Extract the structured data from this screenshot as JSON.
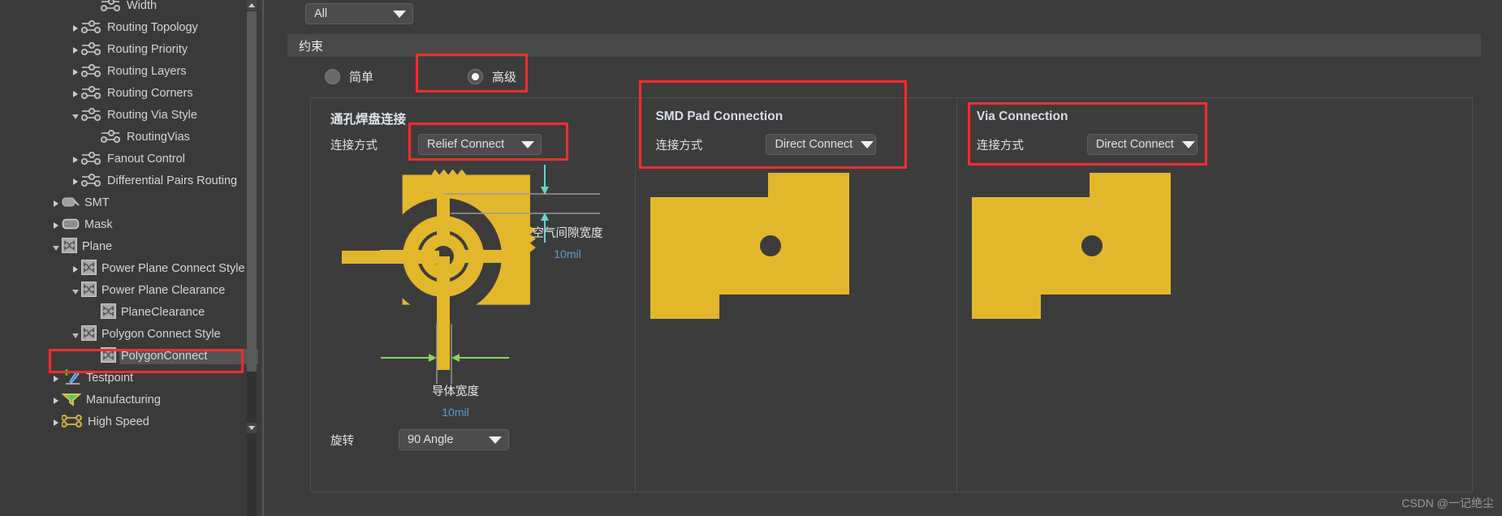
{
  "sidebar": {
    "items": [
      {
        "label": "Width",
        "depth": 4,
        "toggle": "none",
        "icon": "net-rule-icon",
        "selected": false
      },
      {
        "label": "Routing Topology",
        "depth": 3,
        "toggle": "collapsed",
        "icon": "net-rule-icon",
        "selected": false
      },
      {
        "label": "Routing Priority",
        "depth": 3,
        "toggle": "collapsed",
        "icon": "net-rule-icon",
        "selected": false
      },
      {
        "label": "Routing Layers",
        "depth": 3,
        "toggle": "collapsed",
        "icon": "net-rule-icon",
        "selected": false
      },
      {
        "label": "Routing Corners",
        "depth": 3,
        "toggle": "collapsed",
        "icon": "net-rule-icon",
        "selected": false
      },
      {
        "label": "Routing Via Style",
        "depth": 3,
        "toggle": "expanded",
        "icon": "net-rule-icon",
        "selected": false
      },
      {
        "label": "RoutingVias",
        "depth": 4,
        "toggle": "none",
        "icon": "net-rule-icon",
        "selected": false
      },
      {
        "label": "Fanout Control",
        "depth": 3,
        "toggle": "collapsed",
        "icon": "net-rule-icon",
        "selected": false
      },
      {
        "label": "Differential Pairs Routing",
        "depth": 3,
        "toggle": "collapsed",
        "icon": "net-rule-icon",
        "selected": false
      },
      {
        "label": "SMT",
        "depth": 2,
        "toggle": "collapsed",
        "icon": "smt-icon",
        "selected": false
      },
      {
        "label": "Mask",
        "depth": 2,
        "toggle": "collapsed",
        "icon": "mask-icon",
        "selected": false
      },
      {
        "label": "Plane",
        "depth": 2,
        "toggle": "expanded",
        "icon": "plane-icon",
        "selected": false
      },
      {
        "label": "Power Plane Connect Style",
        "depth": 3,
        "toggle": "collapsed",
        "icon": "plane-icon",
        "selected": false
      },
      {
        "label": "Power Plane Clearance",
        "depth": 3,
        "toggle": "expanded",
        "icon": "plane-icon",
        "selected": false
      },
      {
        "label": "PlaneClearance",
        "depth": 4,
        "toggle": "none",
        "icon": "plane-icon",
        "selected": false
      },
      {
        "label": "Polygon Connect Style",
        "depth": 3,
        "toggle": "expanded",
        "icon": "plane-icon",
        "selected": false
      },
      {
        "label": "PolygonConnect",
        "depth": 4,
        "toggle": "none",
        "icon": "plane-icon",
        "selected": true
      },
      {
        "label": "Testpoint",
        "depth": 2,
        "toggle": "collapsed",
        "icon": "testpoint-icon",
        "selected": false
      },
      {
        "label": "Manufacturing",
        "depth": 2,
        "toggle": "collapsed",
        "icon": "manufacturing-icon",
        "selected": false
      },
      {
        "label": "High Speed",
        "depth": 2,
        "toggle": "collapsed",
        "icon": "highspeed-icon",
        "selected": false
      }
    ]
  },
  "filter": {
    "value": "All",
    "arrow_icon": "chevron-down-icon"
  },
  "section": {
    "title": "约束"
  },
  "mode": {
    "simple_label": "简单",
    "advanced_label": "高级",
    "selected": "advanced"
  },
  "through_hole_panel": {
    "title": "通孔焊盘连接",
    "connect_label": "连接方式",
    "connect_value": "Relief Connect",
    "air_gap_label": "空气间隙宽度",
    "air_gap_value": "10mil",
    "conductor_label": "导体宽度",
    "conductor_value": "10mil",
    "rotation_label": "旋转",
    "rotation_value": "90 Angle",
    "arrow_icon": "chevron-down-icon"
  },
  "smd_panel": {
    "title": "SMD Pad Connection",
    "connect_label": "连接方式",
    "connect_value": "Direct Connect",
    "arrow_icon": "chevron-down-icon"
  },
  "via_panel": {
    "title": "Via Connection",
    "connect_label": "连接方式",
    "connect_value": "Direct Connect",
    "arrow_icon": "chevron-down-icon"
  },
  "watermark": {
    "text": "CSDN @一记绝尘"
  },
  "colors": {
    "copper": "#e3b72c",
    "value_blue": "#5b9bd5",
    "annotation_red": "#fb2c2c",
    "panel_bg": "#3c3c3c"
  }
}
